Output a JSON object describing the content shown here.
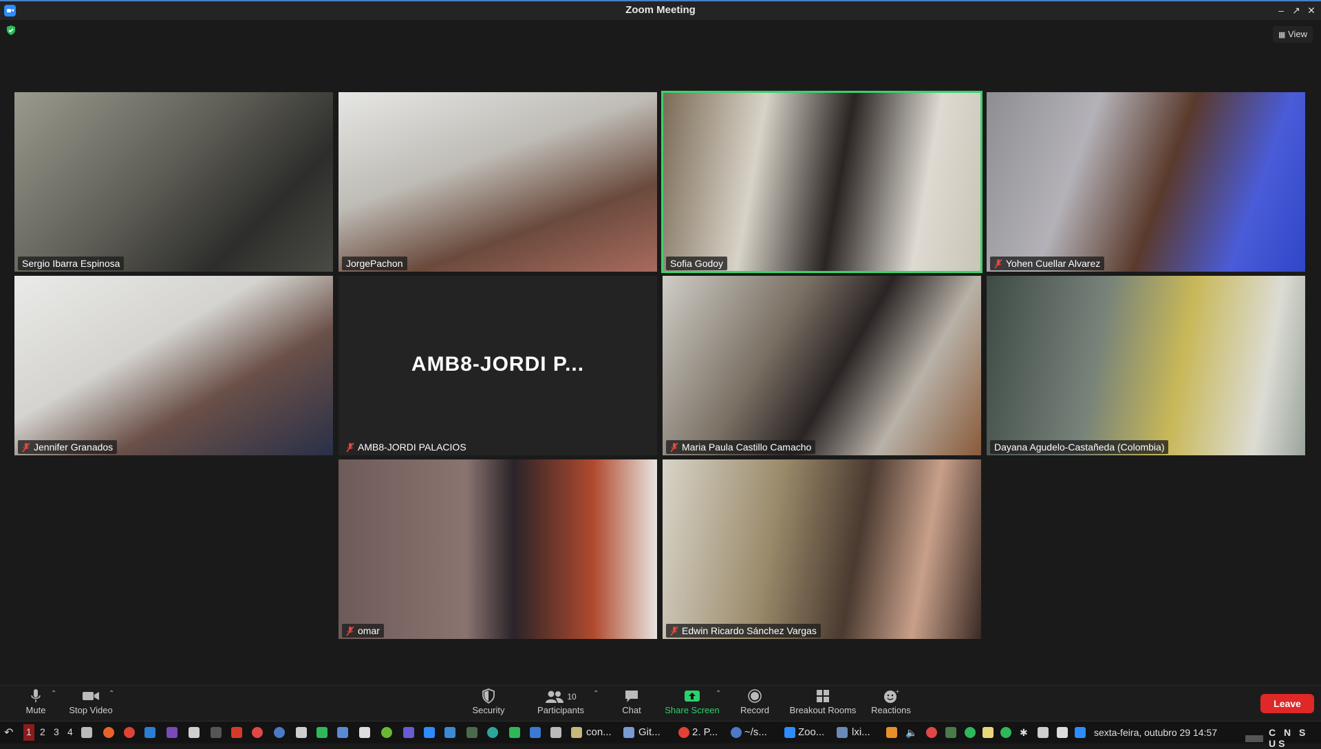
{
  "window": {
    "title": "Zoom Meeting"
  },
  "view_button": {
    "label": "View"
  },
  "participants": [
    {
      "name": "Sergio Ibarra Espinosa",
      "muted": false,
      "active": false
    },
    {
      "name": "JorgePachon",
      "muted": false,
      "active": false
    },
    {
      "name": "Sofia Godoy",
      "muted": false,
      "active": true
    },
    {
      "name": "Yohen Cuellar Alvarez",
      "muted": true,
      "active": false
    },
    {
      "name": "Jennifer Granados",
      "muted": true,
      "active": false
    },
    {
      "name": "AMB8-JORDI PALACIOS",
      "display_name": "AMB8-JORDI P...",
      "muted": true,
      "active": false,
      "video_off": true
    },
    {
      "name": "Maria Paula Castillo Camacho",
      "muted": true,
      "active": false
    },
    {
      "name": "Dayana Agudelo-Castañeda (Colombia)",
      "muted": false,
      "active": false
    },
    {
      "name": "omar",
      "muted": true,
      "active": false
    },
    {
      "name": "Edwin Ricardo Sánchez Vargas",
      "muted": true,
      "active": false
    }
  ],
  "toolbar": {
    "mute": "Mute",
    "stop_video": "Stop Video",
    "security": "Security",
    "participants": "Participants",
    "participants_count": "10",
    "chat": "Chat",
    "share_screen": "Share Screen",
    "record": "Record",
    "breakout_rooms": "Breakout Rooms",
    "reactions": "Reactions",
    "leave": "Leave"
  },
  "taskbar": {
    "workspaces": [
      "1",
      "2",
      "3",
      "4"
    ],
    "windows": [
      "con...",
      "Git...",
      "2. P...",
      "~/s...",
      "Zoo...",
      "lxi..."
    ],
    "clock": "sexta-feira, outubro 29 14:57",
    "keyboard": "C N S US"
  },
  "colors": {
    "active_border": "#3ad36b",
    "share_green": "#2bd16a",
    "leave_red": "#e02828",
    "mute_red": "#e5473c"
  }
}
